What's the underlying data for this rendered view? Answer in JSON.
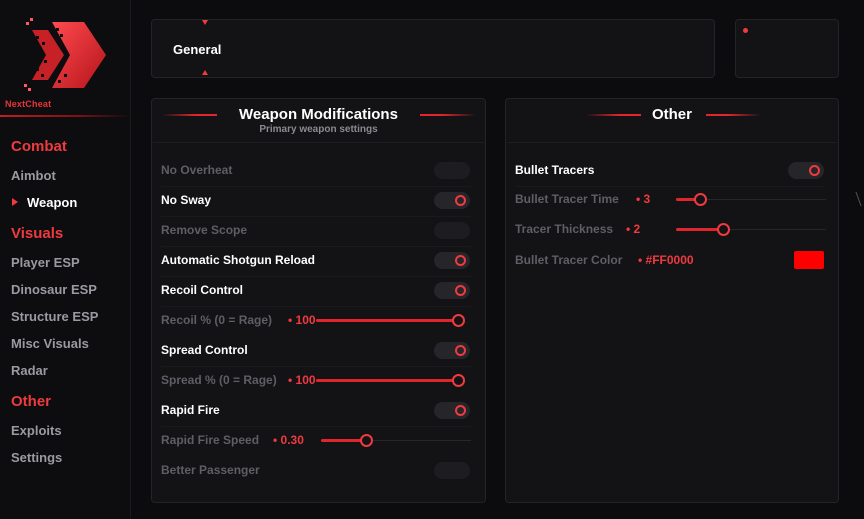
{
  "brand": {
    "name": "NextCheat"
  },
  "colors": {
    "accent": "#ef3a3f",
    "background": "#0c0c0e",
    "panel": "#131316",
    "tracer_color": "#FF0000"
  },
  "sidebar": {
    "sections": [
      {
        "title": "Combat",
        "items": [
          "Aimbot",
          "Weapon"
        ]
      },
      {
        "title": "Visuals",
        "items": [
          "Player ESP",
          "Dinosaur ESP",
          "Structure ESP",
          "Misc Visuals",
          "Radar"
        ]
      },
      {
        "title": "Other",
        "items": [
          "Exploits",
          "Settings"
        ]
      }
    ],
    "active_item": "Weapon"
  },
  "top_tabs": {
    "current": "General"
  },
  "weapon_group": {
    "title": "Weapon Modifications",
    "subtitle": "Primary weapon settings",
    "rows": [
      {
        "label": "No Overheat",
        "type": "toggle",
        "enabled": false
      },
      {
        "label": "No Sway",
        "type": "toggle",
        "enabled": true
      },
      {
        "label": "Remove Scope",
        "type": "toggle",
        "enabled": false
      },
      {
        "label": "Automatic Shotgun Reload",
        "type": "toggle",
        "enabled": true
      },
      {
        "label": "Recoil Control",
        "type": "toggle",
        "enabled": true
      },
      {
        "label": "Recoil % (0 = Rage)",
        "type": "slider",
        "value_text": "• 100",
        "fraction": 1.0
      },
      {
        "label": "Spread Control",
        "type": "toggle",
        "enabled": true
      },
      {
        "label": "Spread % (0 = Rage)",
        "type": "slider",
        "value_text": "• 100",
        "fraction": 1.0
      },
      {
        "label": "Rapid Fire",
        "type": "toggle",
        "enabled": true
      },
      {
        "label": "Rapid Fire Speed",
        "type": "slider",
        "value_text": "• 0.30",
        "fraction": 0.3
      },
      {
        "label": "Better Passenger",
        "type": "toggle",
        "enabled": false
      }
    ]
  },
  "other_group": {
    "title": "Other",
    "rows": [
      {
        "label": "Bullet Tracers",
        "type": "toggle",
        "enabled": true
      },
      {
        "label": "Bullet Tracer Time",
        "type": "slider",
        "value_text": "• 3",
        "fraction": 0.16
      },
      {
        "label": "Tracer Thickness",
        "type": "slider",
        "value_text": "• 2",
        "fraction": 0.31
      },
      {
        "label": "Bullet Tracer Color",
        "type": "color",
        "value_text": "• #FF0000",
        "color": "#FF0000"
      }
    ]
  }
}
